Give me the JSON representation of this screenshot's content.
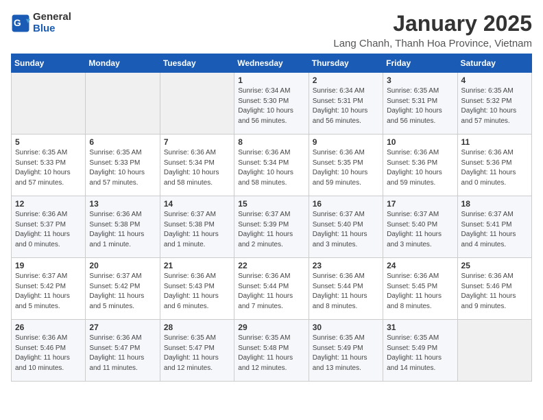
{
  "header": {
    "logo_general": "General",
    "logo_blue": "Blue",
    "title": "January 2025",
    "subtitle": "Lang Chanh, Thanh Hoa Province, Vietnam"
  },
  "days_of_week": [
    "Sunday",
    "Monday",
    "Tuesday",
    "Wednesday",
    "Thursday",
    "Friday",
    "Saturday"
  ],
  "weeks": [
    [
      {
        "day": "",
        "info": ""
      },
      {
        "day": "",
        "info": ""
      },
      {
        "day": "",
        "info": ""
      },
      {
        "day": "1",
        "info": "Sunrise: 6:34 AM\nSunset: 5:30 PM\nDaylight: 10 hours\nand 56 minutes."
      },
      {
        "day": "2",
        "info": "Sunrise: 6:34 AM\nSunset: 5:31 PM\nDaylight: 10 hours\nand 56 minutes."
      },
      {
        "day": "3",
        "info": "Sunrise: 6:35 AM\nSunset: 5:31 PM\nDaylight: 10 hours\nand 56 minutes."
      },
      {
        "day": "4",
        "info": "Sunrise: 6:35 AM\nSunset: 5:32 PM\nDaylight: 10 hours\nand 57 minutes."
      }
    ],
    [
      {
        "day": "5",
        "info": "Sunrise: 6:35 AM\nSunset: 5:33 PM\nDaylight: 10 hours\nand 57 minutes."
      },
      {
        "day": "6",
        "info": "Sunrise: 6:35 AM\nSunset: 5:33 PM\nDaylight: 10 hours\nand 57 minutes."
      },
      {
        "day": "7",
        "info": "Sunrise: 6:36 AM\nSunset: 5:34 PM\nDaylight: 10 hours\nand 58 minutes."
      },
      {
        "day": "8",
        "info": "Sunrise: 6:36 AM\nSunset: 5:34 PM\nDaylight: 10 hours\nand 58 minutes."
      },
      {
        "day": "9",
        "info": "Sunrise: 6:36 AM\nSunset: 5:35 PM\nDaylight: 10 hours\nand 59 minutes."
      },
      {
        "day": "10",
        "info": "Sunrise: 6:36 AM\nSunset: 5:36 PM\nDaylight: 10 hours\nand 59 minutes."
      },
      {
        "day": "11",
        "info": "Sunrise: 6:36 AM\nSunset: 5:36 PM\nDaylight: 11 hours\nand 0 minutes."
      }
    ],
    [
      {
        "day": "12",
        "info": "Sunrise: 6:36 AM\nSunset: 5:37 PM\nDaylight: 11 hours\nand 0 minutes."
      },
      {
        "day": "13",
        "info": "Sunrise: 6:36 AM\nSunset: 5:38 PM\nDaylight: 11 hours\nand 1 minute."
      },
      {
        "day": "14",
        "info": "Sunrise: 6:37 AM\nSunset: 5:38 PM\nDaylight: 11 hours\nand 1 minute."
      },
      {
        "day": "15",
        "info": "Sunrise: 6:37 AM\nSunset: 5:39 PM\nDaylight: 11 hours\nand 2 minutes."
      },
      {
        "day": "16",
        "info": "Sunrise: 6:37 AM\nSunset: 5:40 PM\nDaylight: 11 hours\nand 3 minutes."
      },
      {
        "day": "17",
        "info": "Sunrise: 6:37 AM\nSunset: 5:40 PM\nDaylight: 11 hours\nand 3 minutes."
      },
      {
        "day": "18",
        "info": "Sunrise: 6:37 AM\nSunset: 5:41 PM\nDaylight: 11 hours\nand 4 minutes."
      }
    ],
    [
      {
        "day": "19",
        "info": "Sunrise: 6:37 AM\nSunset: 5:42 PM\nDaylight: 11 hours\nand 5 minutes."
      },
      {
        "day": "20",
        "info": "Sunrise: 6:37 AM\nSunset: 5:42 PM\nDaylight: 11 hours\nand 5 minutes."
      },
      {
        "day": "21",
        "info": "Sunrise: 6:36 AM\nSunset: 5:43 PM\nDaylight: 11 hours\nand 6 minutes."
      },
      {
        "day": "22",
        "info": "Sunrise: 6:36 AM\nSunset: 5:44 PM\nDaylight: 11 hours\nand 7 minutes."
      },
      {
        "day": "23",
        "info": "Sunrise: 6:36 AM\nSunset: 5:44 PM\nDaylight: 11 hours\nand 8 minutes."
      },
      {
        "day": "24",
        "info": "Sunrise: 6:36 AM\nSunset: 5:45 PM\nDaylight: 11 hours\nand 8 minutes."
      },
      {
        "day": "25",
        "info": "Sunrise: 6:36 AM\nSunset: 5:46 PM\nDaylight: 11 hours\nand 9 minutes."
      }
    ],
    [
      {
        "day": "26",
        "info": "Sunrise: 6:36 AM\nSunset: 5:46 PM\nDaylight: 11 hours\nand 10 minutes."
      },
      {
        "day": "27",
        "info": "Sunrise: 6:36 AM\nSunset: 5:47 PM\nDaylight: 11 hours\nand 11 minutes."
      },
      {
        "day": "28",
        "info": "Sunrise: 6:35 AM\nSunset: 5:47 PM\nDaylight: 11 hours\nand 12 minutes."
      },
      {
        "day": "29",
        "info": "Sunrise: 6:35 AM\nSunset: 5:48 PM\nDaylight: 11 hours\nand 12 minutes."
      },
      {
        "day": "30",
        "info": "Sunrise: 6:35 AM\nSunset: 5:49 PM\nDaylight: 11 hours\nand 13 minutes."
      },
      {
        "day": "31",
        "info": "Sunrise: 6:35 AM\nSunset: 5:49 PM\nDaylight: 11 hours\nand 14 minutes."
      },
      {
        "day": "",
        "info": ""
      }
    ]
  ]
}
